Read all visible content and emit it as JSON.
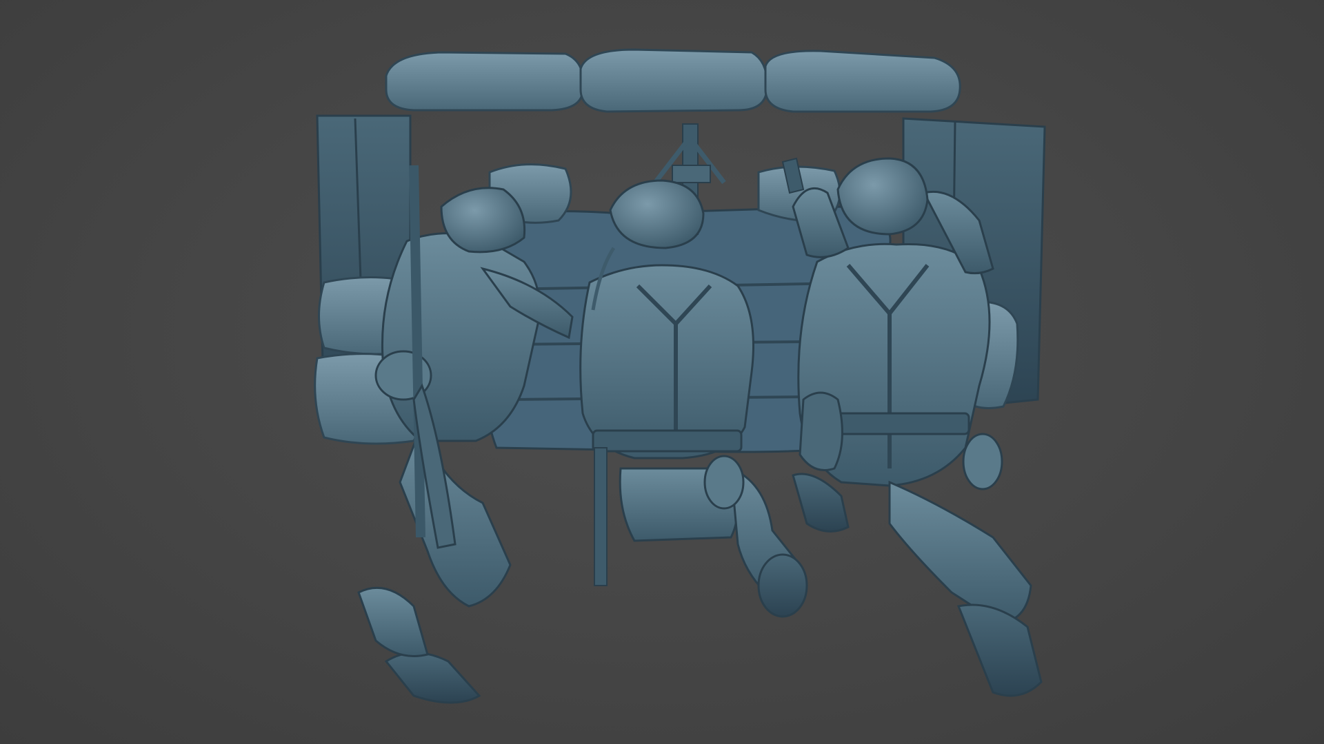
{
  "viewport": {
    "background_color": "#464646",
    "model_color": "#4f7082",
    "model_shadow_color": "#2f4654",
    "model_highlight_color": "#7f9eae"
  },
  "scene": {
    "subject": "three-soldier-machine-gun-nest-sculpt",
    "figures": [
      {
        "role": "rifleman-left",
        "equipment": [
          "helmet",
          "rifle",
          "rolled-blanket",
          "canteen",
          "gas-mask-canister"
        ]
      },
      {
        "role": "machine-gunner-center",
        "equipment": [
          "helmet",
          "y-straps",
          "bayonet",
          "canteen"
        ]
      },
      {
        "role": "pistol-soldier-right",
        "equipment": [
          "helmet",
          "pistol",
          "y-straps",
          "holster",
          "canteen"
        ]
      }
    ],
    "props": [
      "sandbag-roof",
      "wooden-side-boards",
      "log-table",
      "tripod-machine-gun",
      "sandbag-walls"
    ]
  }
}
